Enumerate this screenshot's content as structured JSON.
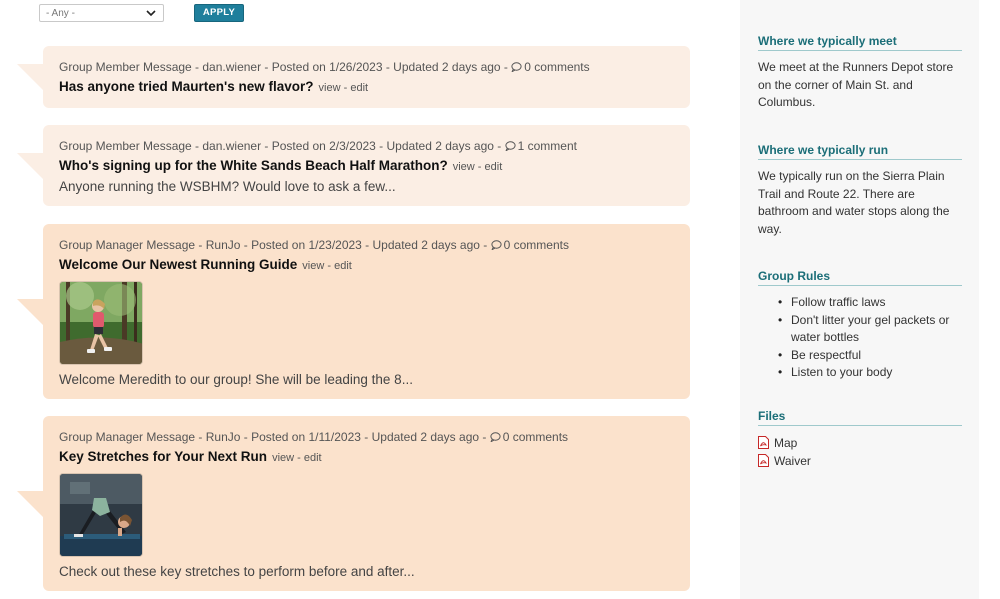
{
  "filter": {
    "select_value": "- Any -",
    "apply_label": "APPLY"
  },
  "messages": [
    {
      "meta": "Group Member Message - dan.wiener - Posted on 1/26/2023 - Updated 2 days ago - ",
      "comments": "0 comments",
      "title": "Has anyone tried Maurten's new flavor?",
      "view": "view",
      "sep": " - ",
      "edit": "edit",
      "excerpt": "",
      "color": "#fbeee4"
    },
    {
      "meta": "Group Member Message - dan.wiener - Posted on 2/3/2023 - Updated 2 days ago - ",
      "comments": "1 comment",
      "title": "Who's signing up for the White Sands Beach Half Marathon?",
      "view": "view",
      "sep": " - ",
      "edit": "edit",
      "excerpt": "Anyone running the WSBHM?  Would love to ask a few...",
      "color": "#fbeee4"
    },
    {
      "meta": "Group Manager Message - RunJo - Posted on 1/23/2023 - Updated 2 days ago - ",
      "comments": "0 comments",
      "title": "Welcome Our Newest Running Guide",
      "view": "view",
      "sep": " - ",
      "edit": "edit",
      "image": "runner-in-forest-photo",
      "excerpt": "Welcome Meredith to our group!  She will be leading the 8...",
      "color": "#fbe2cc"
    },
    {
      "meta": "Group Manager Message - RunJo - Posted on 1/11/2023 - Updated 2 days ago - ",
      "comments": "0 comments",
      "title": "Key Stretches for Your Next Run",
      "view": "view",
      "sep": " - ",
      "edit": "edit",
      "image": "downward-dog-stretch-photo",
      "excerpt": "Check out these key stretches to perform before and after...",
      "color": "#fbe2cc"
    }
  ],
  "sidebar": {
    "meet_heading": "Where we typically meet",
    "meet_text": "We meet at the Runners Depot store on the corner of Main St. and Columbus.",
    "run_heading": "Where we typically run",
    "run_text": "We typically run on the Sierra Plain Trail and Route 22.  There are bathroom and water stops along the way.",
    "rules_heading": "Group Rules",
    "rules": [
      "Follow traffic laws",
      "Don't litter your gel packets or water bottles",
      "Be respectful",
      "Listen to your body"
    ],
    "files_heading": "Files",
    "files": [
      "Map",
      "Waiver"
    ]
  },
  "colors": {
    "accent": "#1b6e78",
    "button": "#1f7f9c",
    "card_light": "#fbeee4",
    "card_dark": "#fbe2cc",
    "sidebar_bg": "#f7f7f7"
  }
}
